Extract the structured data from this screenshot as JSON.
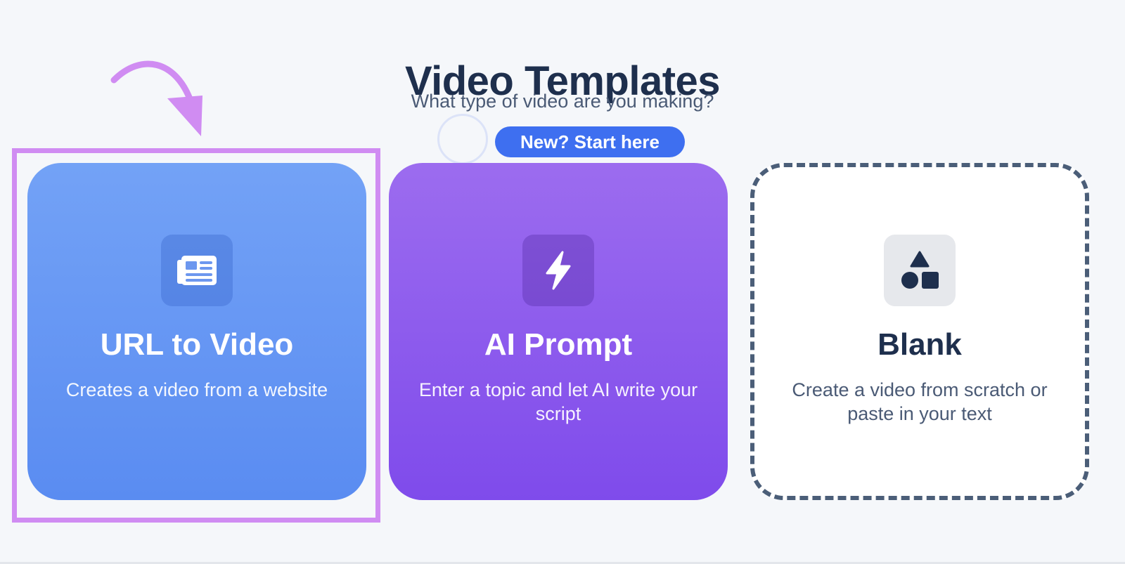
{
  "header": {
    "title": "Video Templates",
    "subtitle": "What type of video are you making?"
  },
  "badge": {
    "label": "New? Start here"
  },
  "cards": [
    {
      "title": "URL to Video",
      "description": "Creates a video from a website",
      "icon": "newspaper-icon",
      "color": "#6a98f4"
    },
    {
      "title": "AI Prompt",
      "description": "Enter a topic and let AI write your script",
      "icon": "lightning-bolt-icon",
      "color": "#8e5cee"
    },
    {
      "title": "Blank",
      "description": "Create a video from scratch or paste in your text",
      "icon": "shapes-icon",
      "color": "#ffffff"
    }
  ],
  "annotation": {
    "highlight_color": "#d08cf2",
    "highlighted_card": "URL to Video"
  }
}
